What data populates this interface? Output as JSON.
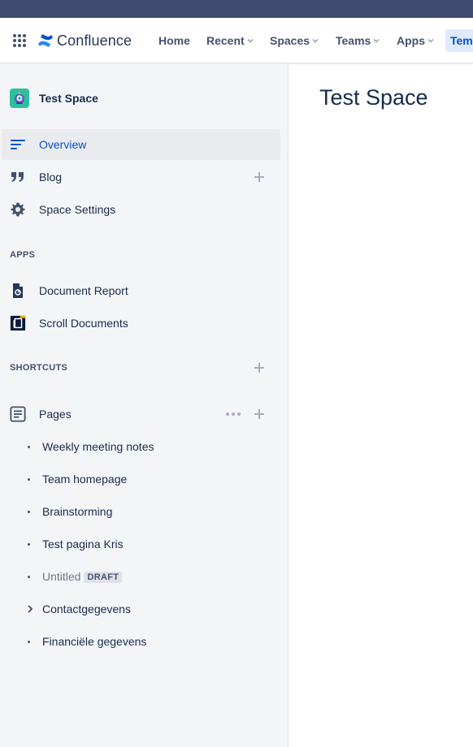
{
  "app": {
    "name": "Confluence",
    "brand_color": "#0052cc"
  },
  "nav": {
    "items": [
      {
        "label": "Home",
        "has_dropdown": false
      },
      {
        "label": "Recent",
        "has_dropdown": true
      },
      {
        "label": "Spaces",
        "has_dropdown": true
      },
      {
        "label": "Teams",
        "has_dropdown": true
      },
      {
        "label": "Apps",
        "has_dropdown": true
      },
      {
        "label": "Tem",
        "active": true
      }
    ]
  },
  "sidebar": {
    "space_name": "Test Space",
    "items": [
      {
        "label": "Overview",
        "icon": "overview-icon",
        "selected": true
      },
      {
        "label": "Blog",
        "icon": "quote-icon"
      },
      {
        "label": "Space Settings",
        "icon": "gear-icon"
      }
    ],
    "apps_heading": "APPS",
    "apps": [
      {
        "label": "Document Report",
        "icon": "document-report-icon"
      },
      {
        "label": "Scroll Documents",
        "icon": "scroll-documents-icon"
      }
    ],
    "shortcuts_heading": "SHORTCUTS",
    "pages_label": "Pages",
    "pages": [
      {
        "label": "Weekly meeting notes",
        "marker": "bullet"
      },
      {
        "label": "Team homepage",
        "marker": "bullet"
      },
      {
        "label": "Brainstorming",
        "marker": "bullet"
      },
      {
        "label": "Test pagina Kris",
        "marker": "bullet"
      },
      {
        "label": "Untitled",
        "marker": "bullet",
        "badge": "DRAFT"
      },
      {
        "label": "Contactgegevens",
        "marker": "caret"
      },
      {
        "label": "Financiële gegevens",
        "marker": "bullet"
      }
    ]
  },
  "main": {
    "title": "Test Space"
  }
}
